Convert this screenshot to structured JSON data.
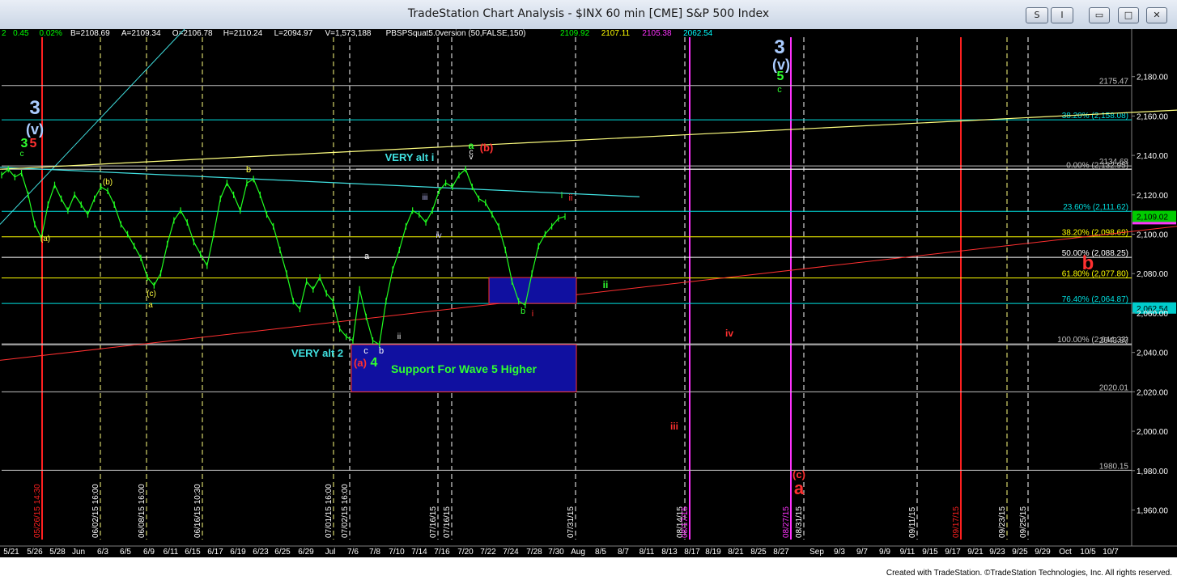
{
  "window": {
    "title": "TradeStation Chart Analysis - $INX 60 min [CME] S&P 500 Index",
    "btn_s": "S",
    "btn_i": "I",
    "btn_min": "▭",
    "btn_max": "□",
    "btn_close": "✕"
  },
  "header_readout": [
    {
      "text": "2",
      "color": "#00ff00"
    },
    {
      "text": "0.45",
      "color": "#00ff00"
    },
    {
      "text": "0.02%",
      "color": "#00ff00"
    },
    {
      "text": "B=2108.69",
      "color": "#ffffff"
    },
    {
      "text": "A=2109.34",
      "color": "#ffffff"
    },
    {
      "text": "O=2106.78",
      "color": "#ffffff"
    },
    {
      "text": "H=2110.24",
      "color": "#ffffff"
    },
    {
      "text": "L=2094.97",
      "color": "#ffffff"
    },
    {
      "text": "V=1,573,188",
      "color": "#ffffff"
    },
    {
      "text": "PBSPSquat5.0version (50,FALSE,150)",
      "color": "#ffffff"
    },
    {
      "text": "2109.92",
      "color": "#00ff00"
    },
    {
      "text": "2107.11",
      "color": "#ffff00"
    },
    {
      "text": "2105.38",
      "color": "#ff33ff"
    },
    {
      "text": "2062.54",
      "color": "#00ffff"
    }
  ],
  "chart_data": {
    "type": "line",
    "title": "$INX 60 min [CME] S&P 500 Index",
    "ylim": [
      1945,
      2200
    ],
    "yticks": [
      1960,
      1980,
      2000,
      2020,
      2040,
      2060,
      2080,
      2100,
      2120,
      2140,
      2160,
      2180
    ],
    "ytick_labels": [
      "1,960.00",
      "1,980.00",
      "2,000.00",
      "2,020.00",
      "2,040.00",
      "2,060.00",
      "2,080.00",
      "2,100.00",
      "2,120.00",
      "2,140.00",
      "2,160.00",
      "2,180.00"
    ],
    "xticks": [
      "5/21",
      "5/26",
      "5/28",
      "Jun",
      "6/3",
      "6/5",
      "6/9",
      "6/11",
      "6/15",
      "6/17",
      "6/19",
      "6/23",
      "6/25",
      "6/29",
      "Jul",
      "7/6",
      "7/8",
      "7/10",
      "7/14",
      "7/16",
      "7/20",
      "7/22",
      "7/24",
      "7/28",
      "7/30",
      "Aug",
      "8/5",
      "8/7",
      "8/11",
      "8/13",
      "8/17",
      "8/19",
      "8/21",
      "8/25",
      "8/27",
      "Sep",
      "9/3",
      "9/7",
      "9/9",
      "9/11",
      "9/15",
      "9/17",
      "9/21",
      "9/23",
      "9/25",
      "9/29",
      "Oct",
      "10/5",
      "10/7"
    ],
    "price_series": {
      "name": "$INX 60 min",
      "points": [
        [
          0,
          2130
        ],
        [
          1,
          2133
        ],
        [
          2,
          2129
        ],
        [
          3,
          2131
        ],
        [
          4,
          2120
        ],
        [
          5,
          2105
        ],
        [
          6,
          2098
        ],
        [
          7,
          2115
        ],
        [
          8,
          2125
        ],
        [
          9,
          2118
        ],
        [
          10,
          2112
        ],
        [
          11,
          2120
        ],
        [
          12,
          2115
        ],
        [
          13,
          2110
        ],
        [
          14,
          2118
        ],
        [
          15,
          2124
        ],
        [
          16,
          2122
        ],
        [
          17,
          2115
        ],
        [
          18,
          2105
        ],
        [
          19,
          2100
        ],
        [
          20,
          2094
        ],
        [
          21,
          2088
        ],
        [
          22,
          2078
        ],
        [
          23,
          2074
        ],
        [
          24,
          2080
        ],
        [
          25,
          2095
        ],
        [
          26,
          2107
        ],
        [
          27,
          2112
        ],
        [
          28,
          2106
        ],
        [
          29,
          2096
        ],
        [
          30,
          2090
        ],
        [
          31,
          2084
        ],
        [
          32,
          2100
        ],
        [
          33,
          2118
        ],
        [
          34,
          2126
        ],
        [
          35,
          2120
        ],
        [
          36,
          2112
        ],
        [
          37,
          2126
        ],
        [
          38,
          2128
        ],
        [
          39,
          2120
        ],
        [
          40,
          2110
        ],
        [
          41,
          2104
        ],
        [
          42,
          2092
        ],
        [
          43,
          2080
        ],
        [
          44,
          2066
        ],
        [
          45,
          2062
        ],
        [
          46,
          2076
        ],
        [
          47,
          2072
        ],
        [
          48,
          2078
        ],
        [
          49,
          2070
        ],
        [
          50,
          2066
        ],
        [
          51,
          2052
        ],
        [
          52,
          2048
        ],
        [
          53,
          2046
        ],
        [
          54,
          2072
        ],
        [
          55,
          2058
        ],
        [
          56,
          2046
        ],
        [
          57,
          2044
        ],
        [
          58,
          2066
        ],
        [
          59,
          2082
        ],
        [
          60,
          2092
        ],
        [
          61,
          2104
        ],
        [
          62,
          2112
        ],
        [
          63,
          2110
        ],
        [
          64,
          2106
        ],
        [
          65,
          2112
        ],
        [
          66,
          2122
        ],
        [
          67,
          2126
        ],
        [
          68,
          2124
        ],
        [
          69,
          2130
        ],
        [
          70,
          2133
        ],
        [
          71,
          2124
        ],
        [
          72,
          2118
        ],
        [
          73,
          2116
        ],
        [
          74,
          2110
        ],
        [
          75,
          2104
        ],
        [
          76,
          2092
        ],
        [
          77,
          2076
        ],
        [
          78,
          2066
        ],
        [
          79,
          2064
        ],
        [
          80,
          2080
        ],
        [
          81,
          2094
        ],
        [
          82,
          2100
        ],
        [
          83,
          2104
        ],
        [
          84,
          2108
        ],
        [
          85,
          2109
        ]
      ]
    },
    "horizontal_levels": [
      {
        "value": 2175.47,
        "label": "2175.47",
        "color": "#c0c0c0"
      },
      {
        "value": 2158.08,
        "label": "38.20% (2,158.08)",
        "color": "#00e0e0"
      },
      {
        "value": 2134.68,
        "label": "2134.68",
        "color": "#c0c0c0"
      },
      {
        "value": 2132.95,
        "label": "0.00% (2,132.95)",
        "color": "#c0c0c0"
      },
      {
        "value": 2111.62,
        "label": "23.60% (2,111.62)",
        "color": "#00e0e0"
      },
      {
        "value": 2098.69,
        "label": "38.20% (2,098.69)",
        "color": "#ffff00"
      },
      {
        "value": 2088.25,
        "label": "50.00% (2,088.25)",
        "color": "#ffffff"
      },
      {
        "value": 2077.8,
        "label": "61.80% (2,077.80)",
        "color": "#ffff00"
      },
      {
        "value": 2064.87,
        "label": "76.40% (2,064.87)",
        "color": "#00e0e0"
      },
      {
        "value": 2044.33,
        "label": "100.00% (2,044.33)",
        "color": "#c0c0c0"
      },
      {
        "value": 2043.87,
        "label": "2043.87",
        "color": "#c0c0c0"
      },
      {
        "value": 2020.01,
        "label": "2020.01",
        "color": "#c0c0c0"
      },
      {
        "value": 1980.15,
        "label": "1980.15",
        "color": "#c0c0c0"
      }
    ],
    "price_tags": [
      {
        "value": 2109.02,
        "label": "2,109.02",
        "bg": "#00cc00",
        "fg": "#000000"
      },
      {
        "value": 2062.54,
        "label": "2,062.54",
        "bg": "#00cccc",
        "fg": "#000000"
      }
    ],
    "vertical_dates": [
      "05/26/15 14:30",
      "06/02/15 16:00",
      "06/08/15 16:00",
      "06/16/15 10:30",
      "07/01/15 16:00",
      "07/02/15 16:00",
      "07/16/15",
      "07/16/15",
      "07/31/15",
      "08/14/15",
      "08/17/15",
      "08/27/15",
      "08/31/15",
      "09/11/15",
      "09/17/15",
      "09/23/15",
      "09/25/15"
    ],
    "support_box_label": "Support For Wave 5 Higher",
    "annotations": {
      "very_alt_i": "VERY alt i",
      "very_alt_2": "VERY alt 2",
      "w3_big": "3",
      "wv_big": "(v)",
      "w3_left": "3",
      "wv_left": "(v)",
      "w3g": "3",
      "w5r": "5",
      "c_top": "c",
      "a_paren": "(a)",
      "c_paren": "(c)",
      "a_yel": "a",
      "b_yel1": "b",
      "b_paren": "(b)",
      "a_green": "a",
      "b_red_paren": "(b)",
      "i_green": "i",
      "ii_red": "ii",
      "iii_lbl": "iii",
      "iv_lbl": "iv",
      "ii_lbl": "ii",
      "a_lbl": "a",
      "c_lbl": "c",
      "b_lbl": "b",
      "ii_small": "ii",
      "b_green": "b",
      "i_red": "i",
      "a_red_paren": "(a)",
      "four_green": "4",
      "ii_green2": "ii",
      "iv_red": "iv",
      "iii_red": "iii",
      "b_big_red": "b",
      "c_red_paren": "(c)",
      "a_big_red": "a",
      "three_blue": "3",
      "v_blue": "(v)",
      "five_green": "5",
      "c_green": "c",
      "v_small": "v",
      "c_small2": "c"
    }
  },
  "footer": "Created with TradeStation. ©TradeStation Technologies, Inc. All rights reserved."
}
